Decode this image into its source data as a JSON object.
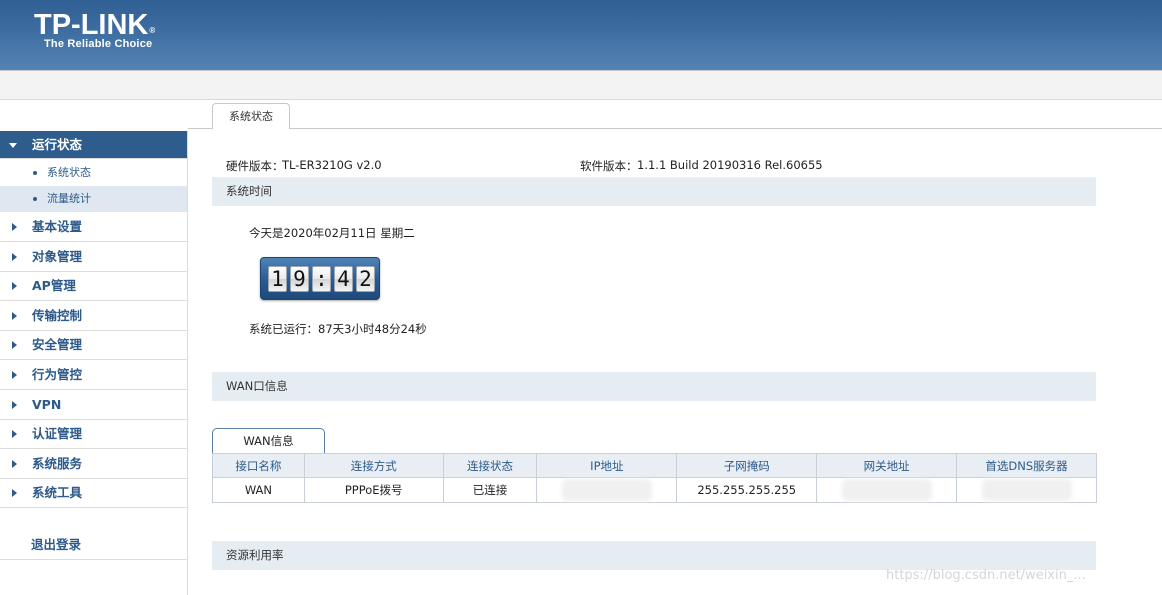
{
  "brand": {
    "logo": "TP-LINK",
    "tm": "®",
    "tagline": "The Reliable Choice"
  },
  "tabs": [
    {
      "label": "系统状态"
    }
  ],
  "sidebar": {
    "active_label": "运行状态",
    "sub_items": [
      {
        "label": "系统状态"
      },
      {
        "label": "流量统计"
      }
    ],
    "items": [
      {
        "label": "基本设置"
      },
      {
        "label": "对象管理"
      },
      {
        "label": "AP管理"
      },
      {
        "label": "传输控制"
      },
      {
        "label": "安全管理"
      },
      {
        "label": "行为管控"
      },
      {
        "label": "VPN"
      },
      {
        "label": "认证管理"
      },
      {
        "label": "系统服务"
      },
      {
        "label": "系统工具"
      }
    ],
    "logout_label": "退出登录"
  },
  "info": {
    "hardware_label": "硬件版本：",
    "hardware_value": "TL-ER3210G v2.0",
    "software_label": "软件版本：",
    "software_value": "1.1.1 Build 20190316 Rel.60655"
  },
  "sections": {
    "system_time": "系统时间",
    "wan_info": "WAN口信息",
    "resource": "资源利用率"
  },
  "system_time": {
    "date_text": "今天是2020年02月11日 星期二",
    "clock_digits": [
      "1",
      "9",
      ":",
      "4",
      "2"
    ],
    "uptime_text": "系统已运行：87天3小时48分24秒"
  },
  "wan": {
    "subtab_label": "WAN信息",
    "headers": [
      "接口名称",
      "连接方式",
      "连接状态",
      "IP地址",
      "子网掩码",
      "网关地址",
      "首选DNS服务器"
    ],
    "row": {
      "iface": "WAN",
      "mode": "PPPoE拨号",
      "status": "已连接",
      "ip": "",
      "mask": "255.255.255.255",
      "gateway": "",
      "dns": ""
    }
  },
  "watermark": "https://blog.csdn.net/weixin_..."
}
